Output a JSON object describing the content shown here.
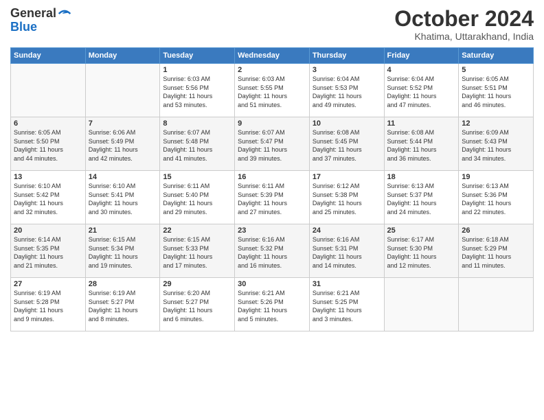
{
  "logo": {
    "line1": "General",
    "line2": "Blue"
  },
  "title": "October 2024",
  "subtitle": "Khatima, Uttarakhand, India",
  "headers": [
    "Sunday",
    "Monday",
    "Tuesday",
    "Wednesday",
    "Thursday",
    "Friday",
    "Saturday"
  ],
  "weeks": [
    [
      {
        "day": "",
        "info": ""
      },
      {
        "day": "",
        "info": ""
      },
      {
        "day": "1",
        "info": "Sunrise: 6:03 AM\nSunset: 5:56 PM\nDaylight: 11 hours\nand 53 minutes."
      },
      {
        "day": "2",
        "info": "Sunrise: 6:03 AM\nSunset: 5:55 PM\nDaylight: 11 hours\nand 51 minutes."
      },
      {
        "day": "3",
        "info": "Sunrise: 6:04 AM\nSunset: 5:53 PM\nDaylight: 11 hours\nand 49 minutes."
      },
      {
        "day": "4",
        "info": "Sunrise: 6:04 AM\nSunset: 5:52 PM\nDaylight: 11 hours\nand 47 minutes."
      },
      {
        "day": "5",
        "info": "Sunrise: 6:05 AM\nSunset: 5:51 PM\nDaylight: 11 hours\nand 46 minutes."
      }
    ],
    [
      {
        "day": "6",
        "info": "Sunrise: 6:05 AM\nSunset: 5:50 PM\nDaylight: 11 hours\nand 44 minutes."
      },
      {
        "day": "7",
        "info": "Sunrise: 6:06 AM\nSunset: 5:49 PM\nDaylight: 11 hours\nand 42 minutes."
      },
      {
        "day": "8",
        "info": "Sunrise: 6:07 AM\nSunset: 5:48 PM\nDaylight: 11 hours\nand 41 minutes."
      },
      {
        "day": "9",
        "info": "Sunrise: 6:07 AM\nSunset: 5:47 PM\nDaylight: 11 hours\nand 39 minutes."
      },
      {
        "day": "10",
        "info": "Sunrise: 6:08 AM\nSunset: 5:45 PM\nDaylight: 11 hours\nand 37 minutes."
      },
      {
        "day": "11",
        "info": "Sunrise: 6:08 AM\nSunset: 5:44 PM\nDaylight: 11 hours\nand 36 minutes."
      },
      {
        "day": "12",
        "info": "Sunrise: 6:09 AM\nSunset: 5:43 PM\nDaylight: 11 hours\nand 34 minutes."
      }
    ],
    [
      {
        "day": "13",
        "info": "Sunrise: 6:10 AM\nSunset: 5:42 PM\nDaylight: 11 hours\nand 32 minutes."
      },
      {
        "day": "14",
        "info": "Sunrise: 6:10 AM\nSunset: 5:41 PM\nDaylight: 11 hours\nand 30 minutes."
      },
      {
        "day": "15",
        "info": "Sunrise: 6:11 AM\nSunset: 5:40 PM\nDaylight: 11 hours\nand 29 minutes."
      },
      {
        "day": "16",
        "info": "Sunrise: 6:11 AM\nSunset: 5:39 PM\nDaylight: 11 hours\nand 27 minutes."
      },
      {
        "day": "17",
        "info": "Sunrise: 6:12 AM\nSunset: 5:38 PM\nDaylight: 11 hours\nand 25 minutes."
      },
      {
        "day": "18",
        "info": "Sunrise: 6:13 AM\nSunset: 5:37 PM\nDaylight: 11 hours\nand 24 minutes."
      },
      {
        "day": "19",
        "info": "Sunrise: 6:13 AM\nSunset: 5:36 PM\nDaylight: 11 hours\nand 22 minutes."
      }
    ],
    [
      {
        "day": "20",
        "info": "Sunrise: 6:14 AM\nSunset: 5:35 PM\nDaylight: 11 hours\nand 21 minutes."
      },
      {
        "day": "21",
        "info": "Sunrise: 6:15 AM\nSunset: 5:34 PM\nDaylight: 11 hours\nand 19 minutes."
      },
      {
        "day": "22",
        "info": "Sunrise: 6:15 AM\nSunset: 5:33 PM\nDaylight: 11 hours\nand 17 minutes."
      },
      {
        "day": "23",
        "info": "Sunrise: 6:16 AM\nSunset: 5:32 PM\nDaylight: 11 hours\nand 16 minutes."
      },
      {
        "day": "24",
        "info": "Sunrise: 6:16 AM\nSunset: 5:31 PM\nDaylight: 11 hours\nand 14 minutes."
      },
      {
        "day": "25",
        "info": "Sunrise: 6:17 AM\nSunset: 5:30 PM\nDaylight: 11 hours\nand 12 minutes."
      },
      {
        "day": "26",
        "info": "Sunrise: 6:18 AM\nSunset: 5:29 PM\nDaylight: 11 hours\nand 11 minutes."
      }
    ],
    [
      {
        "day": "27",
        "info": "Sunrise: 6:19 AM\nSunset: 5:28 PM\nDaylight: 11 hours\nand 9 minutes."
      },
      {
        "day": "28",
        "info": "Sunrise: 6:19 AM\nSunset: 5:27 PM\nDaylight: 11 hours\nand 8 minutes."
      },
      {
        "day": "29",
        "info": "Sunrise: 6:20 AM\nSunset: 5:27 PM\nDaylight: 11 hours\nand 6 minutes."
      },
      {
        "day": "30",
        "info": "Sunrise: 6:21 AM\nSunset: 5:26 PM\nDaylight: 11 hours\nand 5 minutes."
      },
      {
        "day": "31",
        "info": "Sunrise: 6:21 AM\nSunset: 5:25 PM\nDaylight: 11 hours\nand 3 minutes."
      },
      {
        "day": "",
        "info": ""
      },
      {
        "day": "",
        "info": ""
      }
    ]
  ]
}
